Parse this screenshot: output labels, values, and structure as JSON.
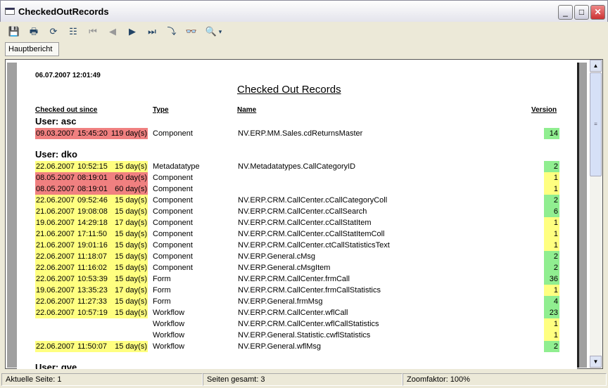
{
  "window": {
    "title": "CheckedOutRecords",
    "min": "_",
    "max": "□",
    "close": "✕"
  },
  "toolbar": {
    "icons": [
      "export-icon",
      "print-icon",
      "refresh-icon",
      "tree-icon",
      "first-page-icon",
      "prev-page-icon",
      "next-page-icon",
      "last-page-icon",
      "goto-page-icon",
      "find-icon",
      "zoom-icon"
    ],
    "glyphs": [
      "💾",
      "🖶",
      "⟳",
      "☷",
      "⏮",
      "◀",
      "▶",
      "⏭",
      "⤵",
      "👓",
      "🔍"
    ],
    "dropdown": "▾"
  },
  "tab": {
    "label": "Hauptbericht"
  },
  "report": {
    "timestamp": "06.07.2007 12:01:49",
    "title": "Checked Out Records",
    "headers": {
      "since": "Checked out since",
      "type": "Type",
      "name": "Name",
      "version": "Version"
    },
    "colors": {
      "red": "#f08080",
      "yellow": "#ffff80",
      "green": "#90ee90"
    },
    "groups": [
      {
        "user": "User:  asc",
        "rows": [
          {
            "date": "09.03.2007",
            "time": "15:45:20",
            "age": "119 day(s)",
            "color": "red",
            "type": "Component",
            "name": "NV.ERP.MM.Sales.cdReturnsMaster",
            "version": "14",
            "vcolor": "green"
          }
        ]
      },
      {
        "user": "User:  dko",
        "rows": [
          {
            "date": "22.06.2007",
            "time": "10:52:15",
            "age": "15 day(s)",
            "color": "yellow",
            "type": "Metadatatype",
            "name": "NV.Metadatatypes.CallCategoryID",
            "version": "2",
            "vcolor": "green"
          },
          {
            "date": "08.05.2007",
            "time": "08:19:01",
            "age": "60 day(s)",
            "color": "red",
            "type": "Component",
            "name": "",
            "version": "1",
            "vcolor": "yellow"
          },
          {
            "date": "08.05.2007",
            "time": "08:19:01",
            "age": "60 day(s)",
            "color": "red",
            "type": "Component",
            "name": "",
            "version": "1",
            "vcolor": "yellow"
          },
          {
            "date": "22.06.2007",
            "time": "09:52:46",
            "age": "15 day(s)",
            "color": "yellow",
            "type": "Component",
            "name": "NV.ERP.CRM.CallCenter.cCallCategoryColl",
            "version": "2",
            "vcolor": "green"
          },
          {
            "date": "21.06.2007",
            "time": "19:08:08",
            "age": "15 day(s)",
            "color": "yellow",
            "type": "Component",
            "name": "NV.ERP.CRM.CallCenter.cCallSearch",
            "version": "6",
            "vcolor": "green"
          },
          {
            "date": "19.06.2007",
            "time": "14:29:18",
            "age": "17 day(s)",
            "color": "yellow",
            "type": "Component",
            "name": "NV.ERP.CRM.CallCenter.cCallStatItem",
            "version": "1",
            "vcolor": "yellow"
          },
          {
            "date": "21.06.2007",
            "time": "17:11:50",
            "age": "15 day(s)",
            "color": "yellow",
            "type": "Component",
            "name": "NV.ERP.CRM.CallCenter.cCallStatItemColl",
            "version": "1",
            "vcolor": "yellow"
          },
          {
            "date": "21.06.2007",
            "time": "19:01:16",
            "age": "15 day(s)",
            "color": "yellow",
            "type": "Component",
            "name": "NV.ERP.CRM.CallCenter.ctCallStatisticsText",
            "version": "1",
            "vcolor": "yellow"
          },
          {
            "date": "22.06.2007",
            "time": "11:18:07",
            "age": "15 day(s)",
            "color": "yellow",
            "type": "Component",
            "name": "NV.ERP.General.cMsg",
            "version": "2",
            "vcolor": "green"
          },
          {
            "date": "22.06.2007",
            "time": "11:16:02",
            "age": "15 day(s)",
            "color": "yellow",
            "type": "Component",
            "name": "NV.ERP.General.cMsgItem",
            "version": "2",
            "vcolor": "green"
          },
          {
            "date": "22.06.2007",
            "time": "10:53:39",
            "age": "15 day(s)",
            "color": "yellow",
            "type": "Form",
            "name": "NV.ERP.CRM.CallCenter.frmCall",
            "version": "36",
            "vcolor": "green"
          },
          {
            "date": "19.06.2007",
            "time": "13:35:23",
            "age": "17 day(s)",
            "color": "yellow",
            "type": "Form",
            "name": "NV.ERP.CRM.CallCenter.frmCallStatistics",
            "version": "1",
            "vcolor": "yellow"
          },
          {
            "date": "22.06.2007",
            "time": "11:27:33",
            "age": "15 day(s)",
            "color": "yellow",
            "type": "Form",
            "name": "NV.ERP.General.frmMsg",
            "version": "4",
            "vcolor": "green"
          },
          {
            "date": "22.06.2007",
            "time": "10:57:19",
            "age": "15 day(s)",
            "color": "yellow",
            "type": "Workflow",
            "name": "NV.ERP.CRM.CallCenter.wflCall",
            "version": "23",
            "vcolor": "green"
          },
          {
            "date": "",
            "time": "",
            "age": "",
            "color": "",
            "type": "Workflow",
            "name": "NV.ERP.CRM.CallCenter.wflCallStatistics",
            "version": "1",
            "vcolor": "yellow"
          },
          {
            "date": "",
            "time": "",
            "age": "",
            "color": "",
            "type": "Workflow",
            "name": "NV.ERP.General.Statistic.cwflStatistics",
            "version": "1",
            "vcolor": "yellow"
          },
          {
            "date": "22.06.2007",
            "time": "11:50:07",
            "age": "15 day(s)",
            "color": "yellow",
            "type": "Workflow",
            "name": "NV.ERP.General.wflMsg",
            "version": "2",
            "vcolor": "green"
          }
        ]
      },
      {
        "user": "User:  gve",
        "rows": []
      }
    ]
  },
  "status": {
    "page": "Aktuelle Seite: 1",
    "total": "Seiten gesamt: 3",
    "zoom": "Zoomfaktor: 100%"
  }
}
